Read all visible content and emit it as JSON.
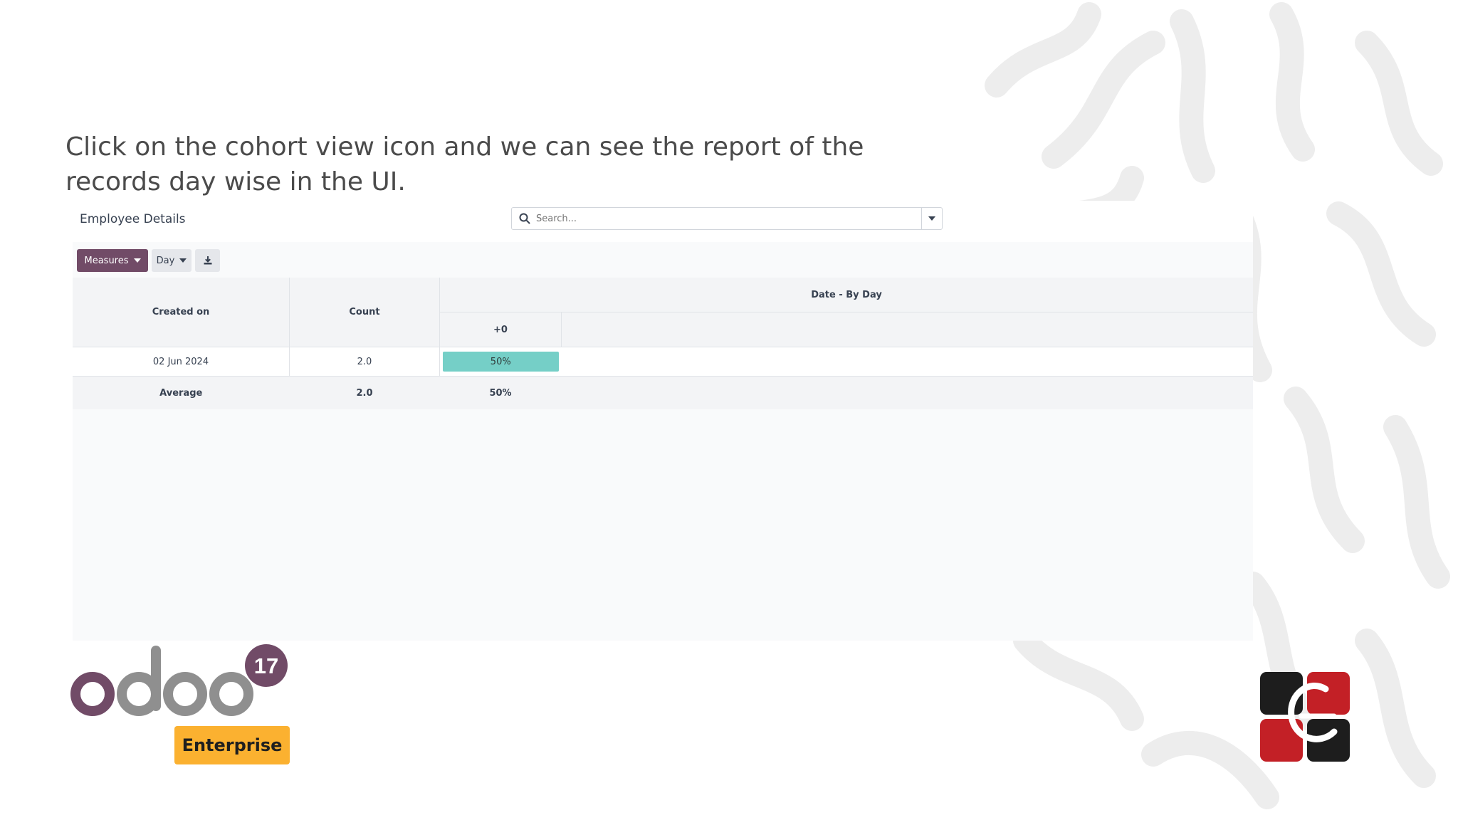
{
  "caption": "Click on the cohort view icon and we can see the report of the records day wise in the UI.",
  "breadcrumb": "Employee Details",
  "search": {
    "placeholder": "Search..."
  },
  "toolbar": {
    "measures_label": "Measures",
    "interval_label": "Day"
  },
  "table": {
    "col_created": "Created on",
    "col_count": "Count",
    "col_date_group": "Date - By Day",
    "col_period0": "+0",
    "rows": [
      {
        "date": "02 Jun 2024",
        "count": "2.0",
        "p0": "50%",
        "p0_value": 50
      }
    ],
    "average": {
      "label": "Average",
      "count": "2.0",
      "p0": "50%"
    }
  },
  "branding": {
    "odoo_version": "17",
    "edition": "Enterprise"
  },
  "colors": {
    "primary": "#714b67",
    "cohort_bar": "#75cfc7",
    "enterprise_badge": "#fbb130"
  }
}
